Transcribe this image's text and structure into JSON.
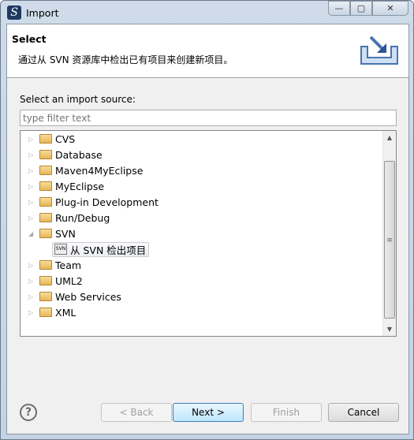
{
  "window": {
    "title": "Import",
    "controls": {
      "minimize": "—",
      "maximize": "▢",
      "close": "✕"
    }
  },
  "header": {
    "title": "Select",
    "description": "通过从 SVN 资源库中检出已有项目来创建新项目。",
    "icon": "import-wizard-icon"
  },
  "source_label": "Select an import source:",
  "filter": {
    "placeholder": "type filter text",
    "value": ""
  },
  "tree": {
    "items": [
      {
        "label": "CVS",
        "expanded": false
      },
      {
        "label": "Database",
        "expanded": false
      },
      {
        "label": "Maven4MyEclipse",
        "expanded": false
      },
      {
        "label": "MyEclipse",
        "expanded": false
      },
      {
        "label": "Plug-in Development",
        "expanded": false
      },
      {
        "label": "Run/Debug",
        "expanded": false
      },
      {
        "label": "SVN",
        "expanded": true,
        "children": [
          {
            "label": "从 SVN 检出项目",
            "selected": true
          }
        ]
      },
      {
        "label": "Team",
        "expanded": false
      },
      {
        "label": "UML2",
        "expanded": false
      },
      {
        "label": "Web Services",
        "expanded": false
      },
      {
        "label": "XML",
        "expanded": false
      }
    ]
  },
  "buttons": {
    "help": "?",
    "back": "< Back",
    "next": "Next >",
    "finish": "Finish",
    "cancel": "Cancel"
  }
}
